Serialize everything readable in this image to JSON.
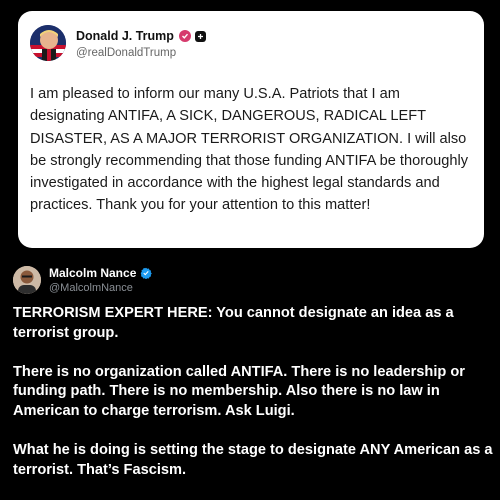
{
  "post": {
    "author": "Donald J. Trump",
    "handle": "@realDonaldTrump",
    "text": "I am pleased to inform our many U.S.A. Patriots that I am designating ANTIFA, A SICK, DANGEROUS, RADICAL LEFT DISASTER, AS A MAJOR TERRORIST ORGANIZATION. I will also be strongly recommending that those funding ANTIFA be thoroughly investigated in accordance with the highest legal standards and practices. Thank you for your attention to this matter!",
    "avatar_icon": "flag-avatar",
    "badges": [
      "verified-pill-icon",
      "plus-square-icon"
    ]
  },
  "reply": {
    "author": "Malcolm Nance",
    "handle": "@MalcolmNance",
    "avatar_icon": "portrait-avatar",
    "verified_color": "#1d9bf0",
    "paragraphs": [
      "TERRORISM EXPERT HERE: You cannot designate an idea as a terrorist group.",
      "There is no organization called ANTIFA.  There is no leadership or funding path. There is no membership.  Also there is no law in American to charge terrorism. Ask Luigi.",
      "What he is doing is setting the stage to designate ANY American as a terrorist. That’s Fascism."
    ]
  },
  "colors": {
    "background": "#000000",
    "card": "#ffffff",
    "badge_pink": "#d63b6d"
  }
}
